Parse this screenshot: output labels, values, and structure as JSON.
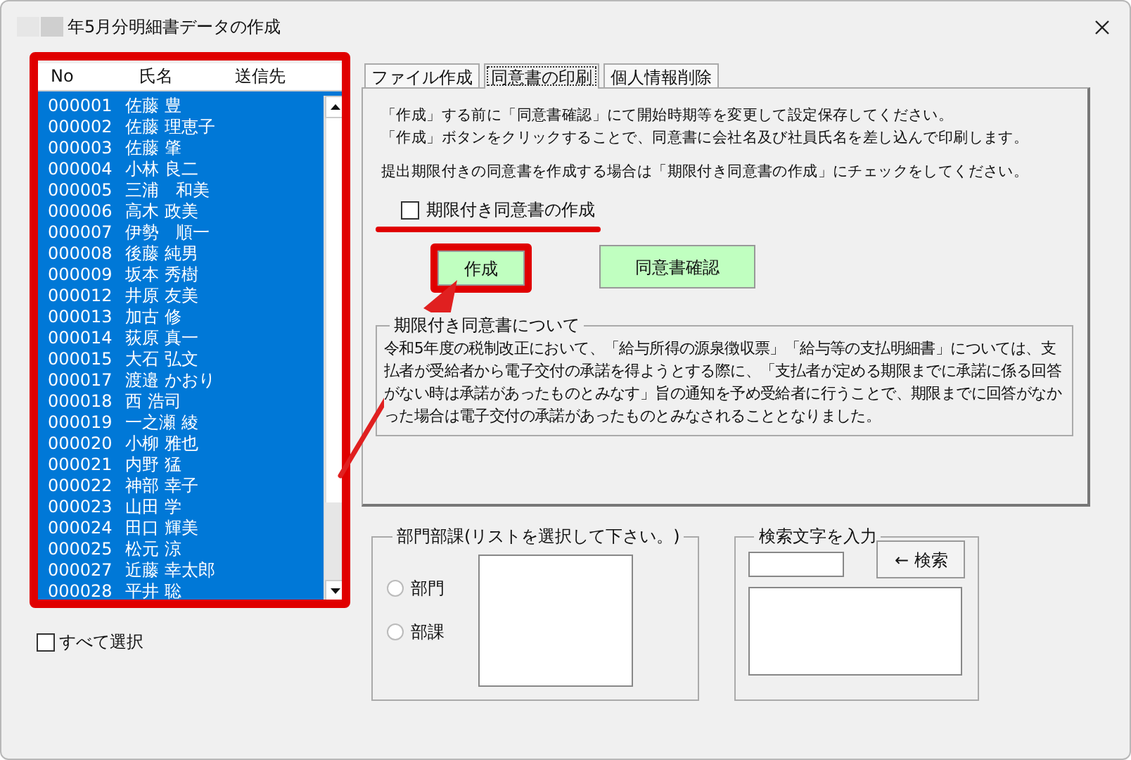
{
  "window": {
    "title": "年5月分明細書データの作成"
  },
  "employee_list": {
    "columns": [
      "No",
      "氏名",
      "送信先"
    ],
    "rows": [
      {
        "no": "000001",
        "name": "佐藤 豊",
        "selected": true
      },
      {
        "no": "000002",
        "name": "佐藤 理恵子",
        "selected": true
      },
      {
        "no": "000003",
        "name": "佐藤 肇",
        "selected": true
      },
      {
        "no": "000004",
        "name": "小林 良二",
        "selected": true
      },
      {
        "no": "000005",
        "name": "三浦　和美",
        "selected": true
      },
      {
        "no": "000006",
        "name": "高木 政美",
        "selected": true
      },
      {
        "no": "000007",
        "name": "伊勢　順一",
        "selected": true
      },
      {
        "no": "000008",
        "name": "後藤 純男",
        "selected": true
      },
      {
        "no": "000009",
        "name": "坂本 秀樹",
        "selected": true
      },
      {
        "no": "000012",
        "name": "井原 友美",
        "selected": true
      },
      {
        "no": "000013",
        "name": "加古 修",
        "selected": true
      },
      {
        "no": "000014",
        "name": "荻原 真一",
        "selected": true
      },
      {
        "no": "000015",
        "name": "大石 弘文",
        "selected": true
      },
      {
        "no": "000017",
        "name": "渡邉 かおり",
        "selected": true
      },
      {
        "no": "000018",
        "name": "西 浩司",
        "selected": true
      },
      {
        "no": "000019",
        "name": "一之瀬 綾",
        "selected": true
      },
      {
        "no": "000020",
        "name": "小柳 雅也",
        "selected": true
      },
      {
        "no": "000021",
        "name": "内野 猛",
        "selected": true
      },
      {
        "no": "000022",
        "name": "神部 幸子",
        "selected": true
      },
      {
        "no": "000023",
        "name": "山田 学",
        "selected": true
      },
      {
        "no": "000024",
        "name": "田口 輝美",
        "selected": true
      },
      {
        "no": "000025",
        "name": "松元 涼",
        "selected": true
      },
      {
        "no": "000027",
        "name": "近藤 幸太郎",
        "selected": true
      },
      {
        "no": "000028",
        "name": "平井 聡",
        "selected": true
      }
    ]
  },
  "select_all": {
    "label": "すべて選択",
    "checked": false
  },
  "tabs": [
    {
      "label": "ファイル作成",
      "selected": false
    },
    {
      "label": "同意書の印刷",
      "selected": true
    },
    {
      "label": "個人情報削除",
      "selected": false
    }
  ],
  "instructions": [
    "「作成」する前に「同意書確認」にて開始時期等を変更して設定保存してください。",
    "「作成」ボタンをクリックすることで、同意書に会社名及び社員氏名を差し込んで印刷します。",
    "提出期限付きの同意書を作成する場合は「期限付き同意書の作成」にチェックをしてください。"
  ],
  "deadline_checkbox": {
    "label": "期限付き同意書の作成",
    "checked": false
  },
  "buttons": [
    "作成",
    "同意書確認"
  ],
  "about_group": {
    "legend": "期限付き同意書について",
    "text": "令和5年度の税制改正において、「給与所得の源泉徴収票」「給与等の支払明細書」については、支払者が受給者から電子交付の承諾を得ようとする際に、「支払者が定める期限までに承諾に係る回答がない時は承諾があったものとみなす」旨の通知を予め受給者に行うことで、期限までに回答がなかった場合は電子交付の承諾があったものとみなされることとなりました。"
  },
  "department_group": {
    "legend": "部門部課(リストを選択して下さい。)",
    "radios": [
      {
        "label": "部門",
        "selected": false
      },
      {
        "label": "部課",
        "selected": false
      }
    ]
  },
  "search_group": {
    "legend": "検索文字を入力",
    "button": "← 検索"
  }
}
